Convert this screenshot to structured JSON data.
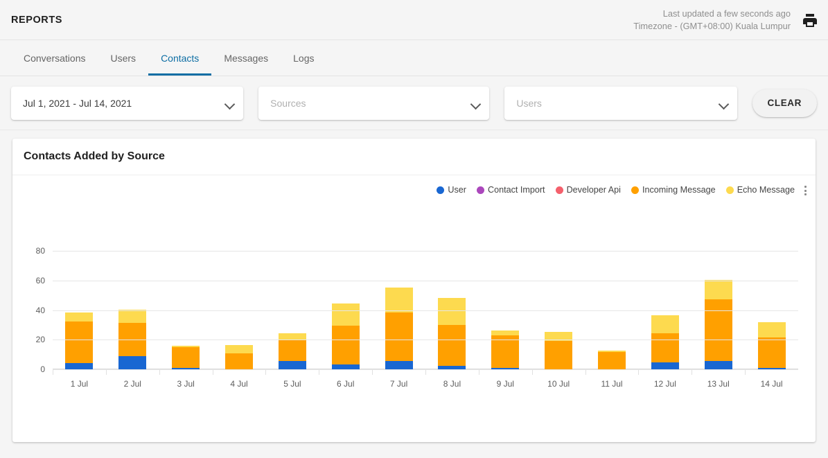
{
  "topbar": {
    "title": "REPORTS",
    "last_updated": "Last updated a few seconds ago",
    "timezone": "Timezone - (GMT+08:00) Kuala Lumpur",
    "print_icon": "printer-icon"
  },
  "tabs": [
    {
      "label": "Conversations",
      "active": false
    },
    {
      "label": "Users",
      "active": false
    },
    {
      "label": "Contacts",
      "active": true
    },
    {
      "label": "Messages",
      "active": false
    },
    {
      "label": "Logs",
      "active": false
    }
  ],
  "filters": {
    "date_range_value": "Jul 1, 2021 - Jul 14, 2021",
    "sources_placeholder": "Sources",
    "sources_value": "",
    "users_placeholder": "Users",
    "users_value": "",
    "clear_label": "CLEAR",
    "chevron_icon": "chevron-down-icon"
  },
  "card": {
    "title": "Contacts Added by Source",
    "menu_icon": "more-vert-icon"
  },
  "chart_data": {
    "type": "bar",
    "stacked": true,
    "title": "Contacts Added by Source",
    "xlabel": "",
    "ylabel": "",
    "ylim": [
      0,
      90
    ],
    "yticks": [
      0,
      20,
      40,
      60,
      80
    ],
    "grid": true,
    "legend_position": "top-right",
    "categories": [
      "1 Jul",
      "2 Jul",
      "3 Jul",
      "4 Jul",
      "5 Jul",
      "6 Jul",
      "7 Jul",
      "8 Jul",
      "9 Jul",
      "10 Jul",
      "11 Jul",
      "12 Jul",
      "13 Jul",
      "14 Jul"
    ],
    "series": [
      {
        "name": "User",
        "color": "#1967d2",
        "values": [
          4,
          9,
          1,
          0,
          5.5,
          3.5,
          5.5,
          2.5,
          1,
          0,
          0,
          4.5,
          5.5,
          1
        ]
      },
      {
        "name": "Contact Import",
        "color": "#ab47bc",
        "values": [
          0,
          0,
          0,
          0,
          0,
          0,
          0,
          0,
          0,
          0,
          0,
          0,
          0,
          0
        ]
      },
      {
        "name": "Developer Api",
        "color": "#f4606c",
        "values": [
          0,
          0,
          0,
          0,
          0,
          0,
          0,
          0,
          0,
          0,
          0,
          0,
          0,
          0
        ]
      },
      {
        "name": "Incoming Message",
        "color": "#ffa000",
        "values": [
          28.5,
          22.5,
          14,
          11,
          14.5,
          26,
          33,
          27.5,
          22,
          19,
          11.5,
          20,
          42,
          20.5
        ]
      },
      {
        "name": "Echo Message",
        "color": "#fdda4f",
        "values": [
          6,
          9,
          1,
          5.5,
          4.5,
          15,
          17,
          18.5,
          3.5,
          6.5,
          1,
          12,
          13,
          10.5
        ]
      }
    ],
    "totals": [
      38.5,
      40.5,
      16,
      16.5,
      24.5,
      44.5,
      55.5,
      48.5,
      26.5,
      25.5,
      12.5,
      36.5,
      60.5,
      32
    ]
  }
}
